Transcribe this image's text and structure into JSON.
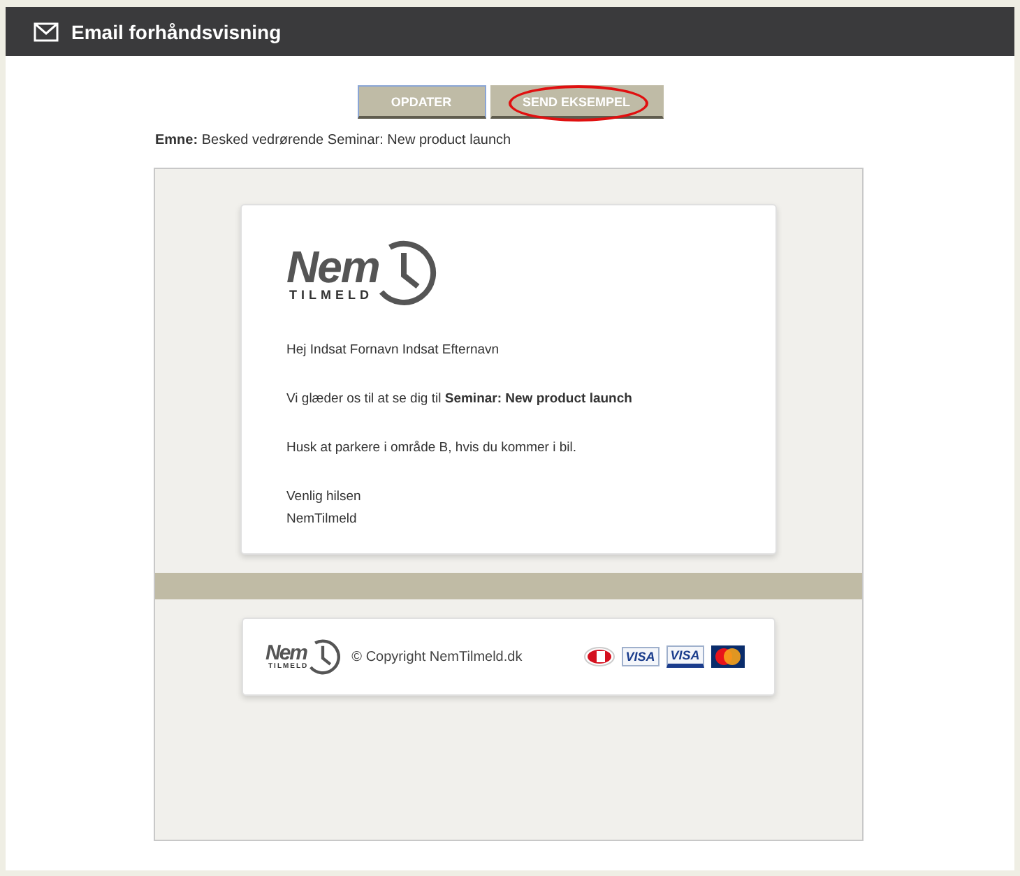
{
  "window": {
    "title": "Email forhåndsvisning"
  },
  "buttons": [
    {
      "label": "OPDATER",
      "focused": true,
      "highlighted": false
    },
    {
      "label": "SEND EKSEMPEL",
      "focused": false,
      "highlighted": true
    }
  ],
  "subject": {
    "label": "Emne:",
    "value": "Besked vedrørende Seminar: New product launch"
  },
  "email": {
    "logo": {
      "word": "Nem",
      "sub": "TILMELD"
    },
    "paragraphs": [
      "Hej Indsat Fornavn Indsat Efternavn",
      "Vi glæder os til at se dig til **Seminar: New product launch**",
      "Husk at parkere i område B, hvis du kommer i bil."
    ],
    "signoff": [
      "Venlig hilsen",
      "NemTilmeld"
    ]
  },
  "footer": {
    "logo": {
      "word": "Nem",
      "sub": "TILMELD"
    },
    "copyright": "© Copyright NemTilmeld.dk",
    "cards": [
      {
        "kind": "dankort"
      },
      {
        "kind": "visa",
        "label": "VISA"
      },
      {
        "kind": "visa-electron",
        "label": "VISA"
      },
      {
        "kind": "mastercard"
      }
    ]
  }
}
